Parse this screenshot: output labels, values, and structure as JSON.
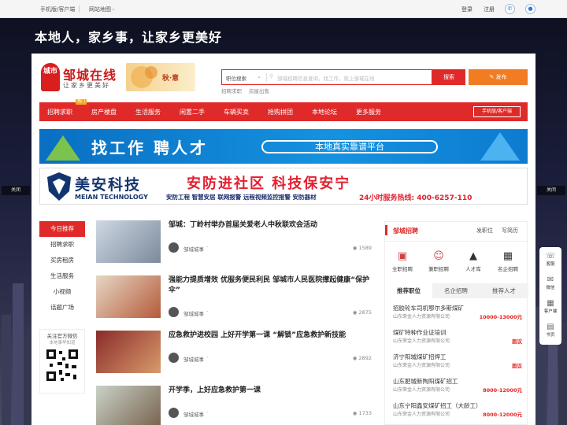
{
  "topbar": {
    "mobile_label": "手机版/客户端",
    "sitemap_label": "网站地图",
    "login": "登录",
    "register": "注册"
  },
  "hero": {
    "slogan": "本地人，家乡事，让家乡更美好",
    "close_left": "关闭",
    "close_right": "关闭"
  },
  "header": {
    "logo_badge": "城市",
    "logo_name": "邹城在线",
    "logo_tagline": "让家乡更美好",
    "autumn_text": "秋·意"
  },
  "search": {
    "category": "职位搜索",
    "placeholder": "邹城招聘信息查询，找工作，就上邹城在线",
    "button": "搜索",
    "hot_words": [
      "招聘求职",
      "房屋出售"
    ]
  },
  "publish_button": "发布",
  "nav": {
    "items": [
      "招聘求职",
      "房产楼盘",
      "生活服务",
      "闲置二手",
      "车辆买卖",
      "抢购拼团",
      "本地论坛",
      "更多服务"
    ],
    "hot_badge": "热门",
    "mobile_button": "手机版/客户端"
  },
  "banner1": {
    "title": "找工作 聘人才",
    "pill": "本地真实靠谱平台"
  },
  "banner2": {
    "brand": "美安科技",
    "brand_en": "MEIAN TECHNOLOGY",
    "headline": "安防进社区 科技保安宁",
    "services": "安防工程  智慧安居  联网报警  远程视频监控报警  安防器材",
    "hotline": "24小时服务热线: 400-6257-110"
  },
  "sidebar": {
    "items": [
      "今日推荐",
      "招聘求职",
      "买房租房",
      "生活服务",
      "小视频",
      "话题广场"
    ],
    "qr_title": "关注官方微信",
    "qr_sub": "本地事早知道"
  },
  "news": [
    {
      "title": "邹城：丁岭村举办首届关爱老人中秋联欢会活动",
      "source": "邹城城事",
      "views": "1589"
    },
    {
      "title": "强能力提质增效 优服务便民利民 邹城市人民医院撑起健康“保护伞”",
      "source": "邹城城事",
      "views": "2875"
    },
    {
      "title": "应急救护进校园 上好开学第一课 “解锁”应急救护新技能",
      "source": "邹城城事",
      "views": "2892"
    },
    {
      "title": "开学季，上好应急救护第一课",
      "source": "邹城城事",
      "views": "1733"
    }
  ],
  "recruit": {
    "heading": "邹城招聘",
    "post_job": "发职位",
    "write_resume": "写简历",
    "icons": [
      {
        "label": "全职招聘",
        "icon": "briefcase-icon"
      },
      {
        "label": "兼职招聘",
        "icon": "person-icon"
      },
      {
        "label": "人才库",
        "icon": "graduate-cap-icon"
      },
      {
        "label": "名企招聘",
        "icon": "building-icon"
      }
    ],
    "tabs": [
      "推荐职位",
      "名企招聘",
      "推荐人才"
    ],
    "jobs": [
      {
        "title": "招胶轮车司机鄂尔多斯煤矿",
        "company": "山东荣金人力资源有限公司",
        "salary": "10000-13000元"
      },
      {
        "title": "煤矿特种作业证培训",
        "company": "山东荣金人力资源有限公司",
        "salary": "面议"
      },
      {
        "title": "济宁阳城煤矿招焊工",
        "company": "山东荣金人力资源有限公司",
        "salary": "面议"
      },
      {
        "title": "山东肥城新陶阳煤矿招工",
        "company": "山东荣金人力资源有限公司",
        "salary": "8000-12000元"
      },
      {
        "title": "山东宁阳鑫安煤矿招工（大龄工）",
        "company": "山东荣金人力资源有限公司",
        "salary": "8000-12000元"
      }
    ]
  },
  "floatbar": {
    "items": [
      "客服",
      "微信",
      "客户端",
      "书页"
    ]
  },
  "colors": {
    "brand_red": "#e02a2a",
    "orange": "#f27c22",
    "salary_red": "#e5211f"
  }
}
